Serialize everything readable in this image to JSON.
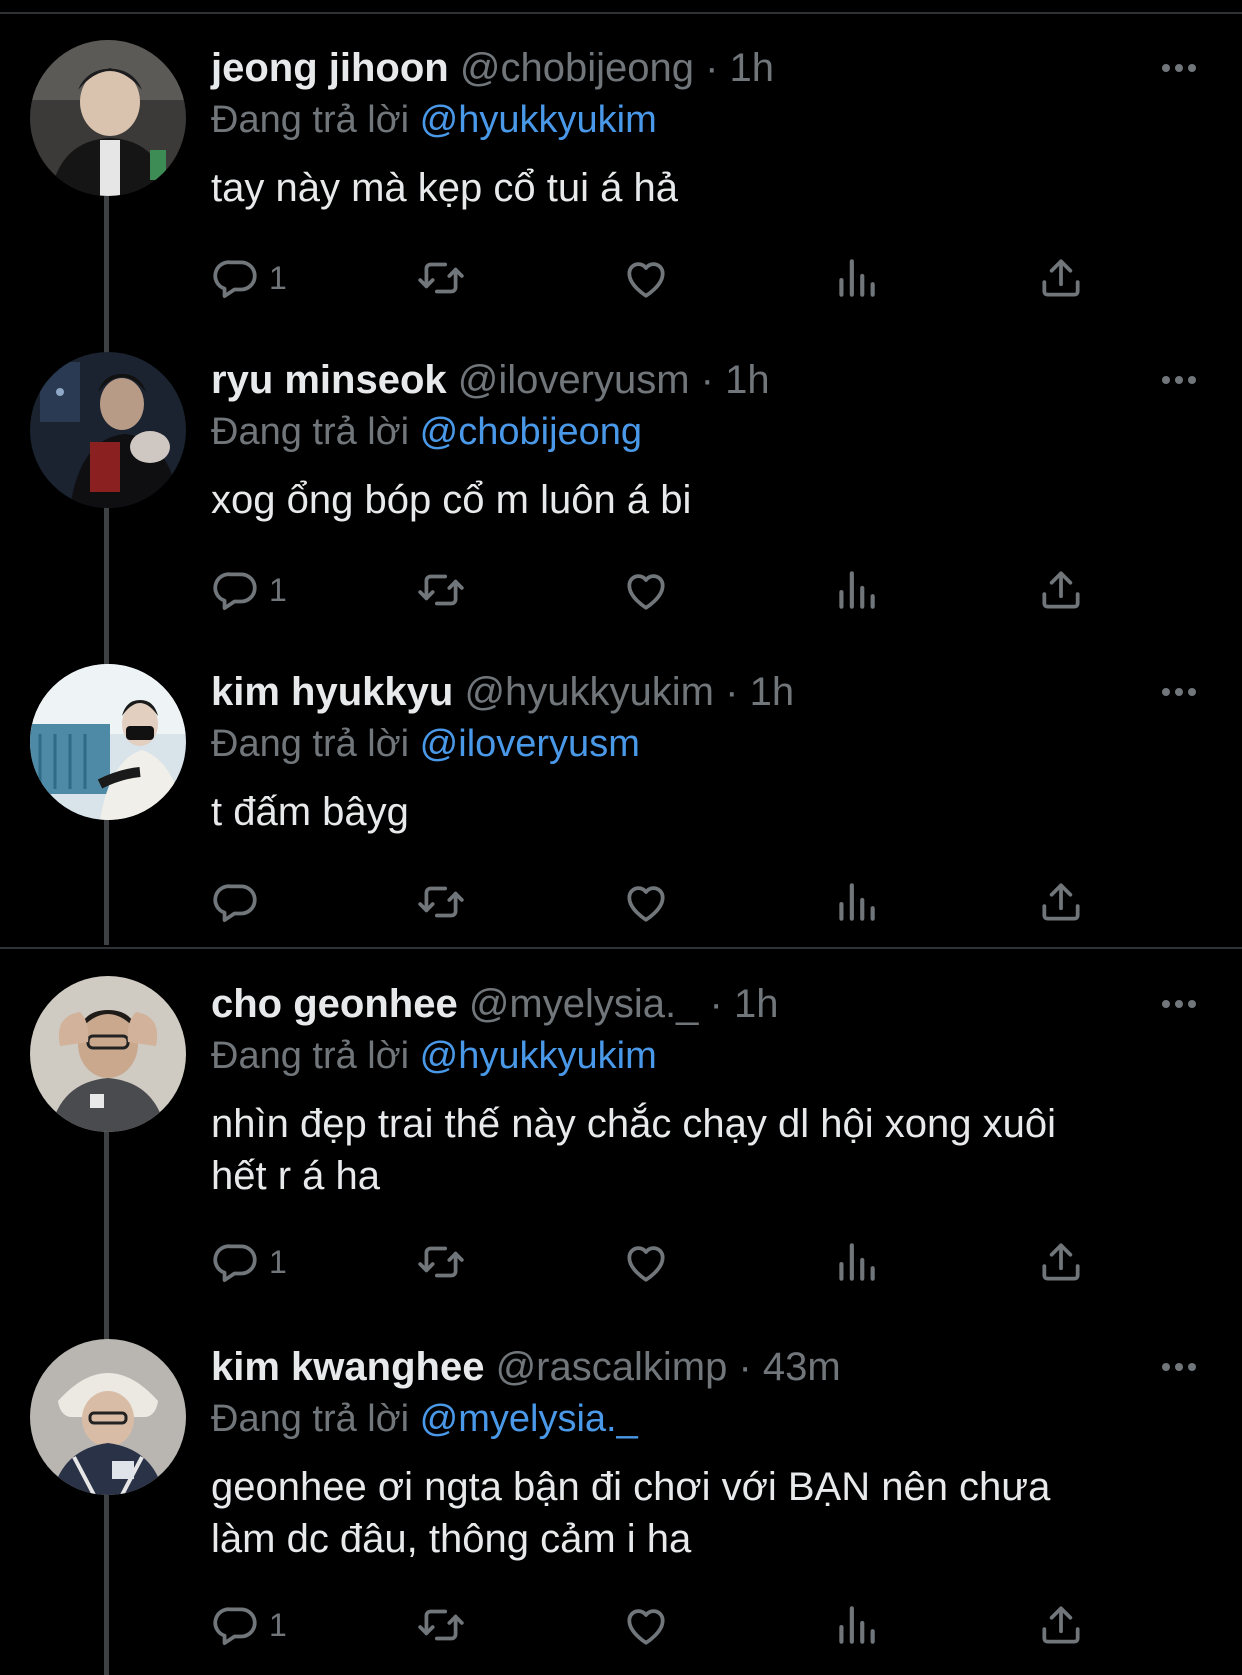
{
  "colors": {
    "background": "#000000",
    "name": "#e7e9ea",
    "secondary": "#71767b",
    "mention": "#4a99e9",
    "thread_line": "#3e4144"
  },
  "tweets": [
    {
      "name": "jeong jihoon",
      "handle": "@chobijeong",
      "sep": "·",
      "time": "1h",
      "replying_prefix": "Đang trả lời",
      "replying_to": "@hyukkyukim",
      "text": "tay này mà kẹp cổ tui á hả",
      "reply_count": "1"
    },
    {
      "name": "ryu minseok",
      "handle": "@iloveryusm",
      "sep": "·",
      "time": "1h",
      "replying_prefix": "Đang trả lời",
      "replying_to": "@chobijeong",
      "text": "xog ổng bóp cổ m luôn á bi",
      "reply_count": "1"
    },
    {
      "name": "kim hyukkyu",
      "handle": "@hyukkyukim",
      "sep": "·",
      "time": "1h",
      "replying_prefix": "Đang trả lời",
      "replying_to": "@iloveryusm",
      "text": "t đấm bâyg",
      "reply_count": ""
    },
    {
      "name": "cho geonhee",
      "handle": "@myelysia._",
      "sep": "·",
      "time": "1h",
      "replying_prefix": "Đang trả lời",
      "replying_to": "@hyukkyukim",
      "text_lines": [
        "nhìn đẹp trai thế này chắc chạy dl hội xong xuôi",
        "hết r á ha"
      ],
      "reply_count": "1"
    },
    {
      "name": "kim kwanghee",
      "handle": "@rascalkimp",
      "sep": "·",
      "time": "43m",
      "replying_prefix": "Đang trả lời",
      "replying_to": "@myelysia._",
      "text_lines": [
        "geonhee ơi ngta bận đi chơi với BẠN nên chưa",
        "làm dc đâu, thông cảm i ha"
      ],
      "reply_count": "1"
    }
  ],
  "icons": [
    "reply-icon",
    "retweet-icon",
    "like-icon",
    "views-icon",
    "share-icon",
    "more-icon"
  ]
}
